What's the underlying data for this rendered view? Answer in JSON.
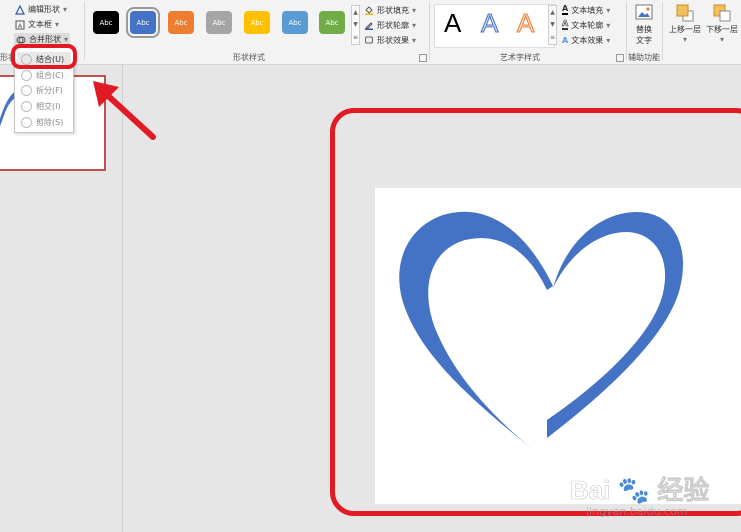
{
  "ribbon": {
    "shape_cmds": {
      "edit_shape": "编辑形状",
      "text_box": "文本框",
      "merge_shapes": "合并形状",
      "group_label_partial": "形状"
    },
    "style_swatches": [
      {
        "label": "Abc",
        "color": "#000000",
        "text_color": "#ffffff"
      },
      {
        "label": "Abc",
        "color": "#4472c4",
        "text_color": "#ffffff"
      },
      {
        "label": "Abc",
        "color": "#ed7d31",
        "text_color": "#ffffff"
      },
      {
        "label": "Abc",
        "color": "#a5a5a5",
        "text_color": "#ffffff"
      },
      {
        "label": "Abc",
        "color": "#ffc000",
        "text_color": "#ffffff"
      },
      {
        "label": "Abc",
        "color": "#5b9bd5",
        "text_color": "#ffffff"
      },
      {
        "label": "Abc",
        "color": "#70ad47",
        "text_color": "#ffffff"
      }
    ],
    "shape_format": {
      "fill": "形状填充",
      "outline": "形状轮廓",
      "effects": "形状效果"
    },
    "shape_styles_label": "形状样式",
    "wordart": {
      "letters": [
        {
          "char": "A",
          "style": "black"
        },
        {
          "char": "A",
          "style": "blue-outline"
        },
        {
          "char": "A",
          "style": "orange-outline"
        }
      ],
      "text_fill": "文本填充",
      "text_outline": "文本轮廓",
      "text_effects": "文本效果",
      "label": "艺术字样式"
    },
    "accessibility": {
      "alt_text_line1": "替换",
      "alt_text_line2": "文字",
      "label": "辅助功能"
    },
    "arrange": {
      "bring_forward": "上移一层",
      "send_backward": "下移一层"
    }
  },
  "merge_menu": {
    "items": [
      {
        "label": "结合(U)",
        "state": "highlighted"
      },
      {
        "label": "组合(C)",
        "state": "disabled"
      },
      {
        "label": "拆分(F)",
        "state": "disabled"
      },
      {
        "label": "相交(I)",
        "state": "disabled"
      },
      {
        "label": "剪除(S)",
        "state": "disabled"
      }
    ]
  },
  "colors": {
    "heart_blue": "#4472c4",
    "annotation_red": "#e21a23",
    "thumb_border": "#c0504d"
  },
  "watermark": {
    "brand": "Bai",
    "brand_cn": "经验",
    "url": "jingyan.baidu.com"
  }
}
